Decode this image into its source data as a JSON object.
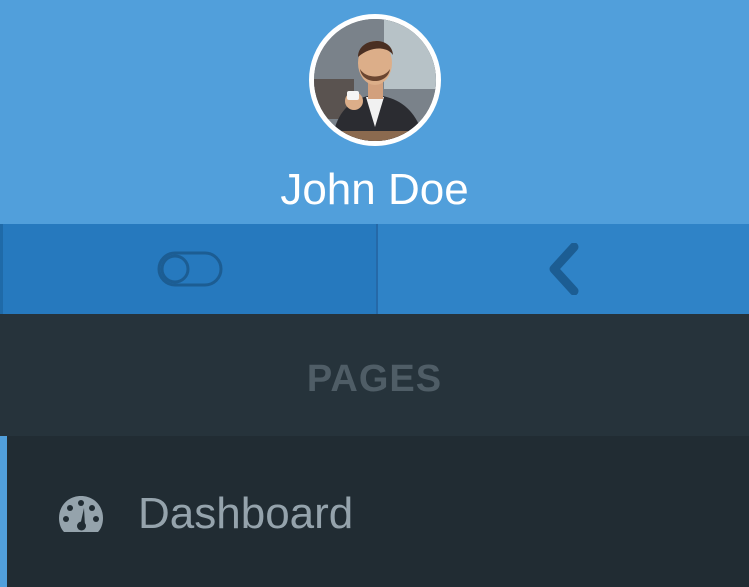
{
  "profile": {
    "user_name": "John Doe",
    "avatar_icon": "user-avatar-photo"
  },
  "controls": {
    "left_icon": "toggle-icon",
    "right_icon": "chevron-left-icon"
  },
  "section": {
    "title": "PAGES"
  },
  "nav": {
    "items": [
      {
        "label": "Dashboard",
        "icon": "dashboard-icon",
        "active": true
      }
    ]
  },
  "colors": {
    "profile_bg": "#519fdb",
    "controls_bg": "#2f83c7",
    "controls_active_bg": "#2679be",
    "section_bg": "#26333b",
    "nav_bg": "#212c33",
    "accent": "#519fdb",
    "nav_text": "#95a3ac",
    "section_text": "#4f5d66"
  }
}
